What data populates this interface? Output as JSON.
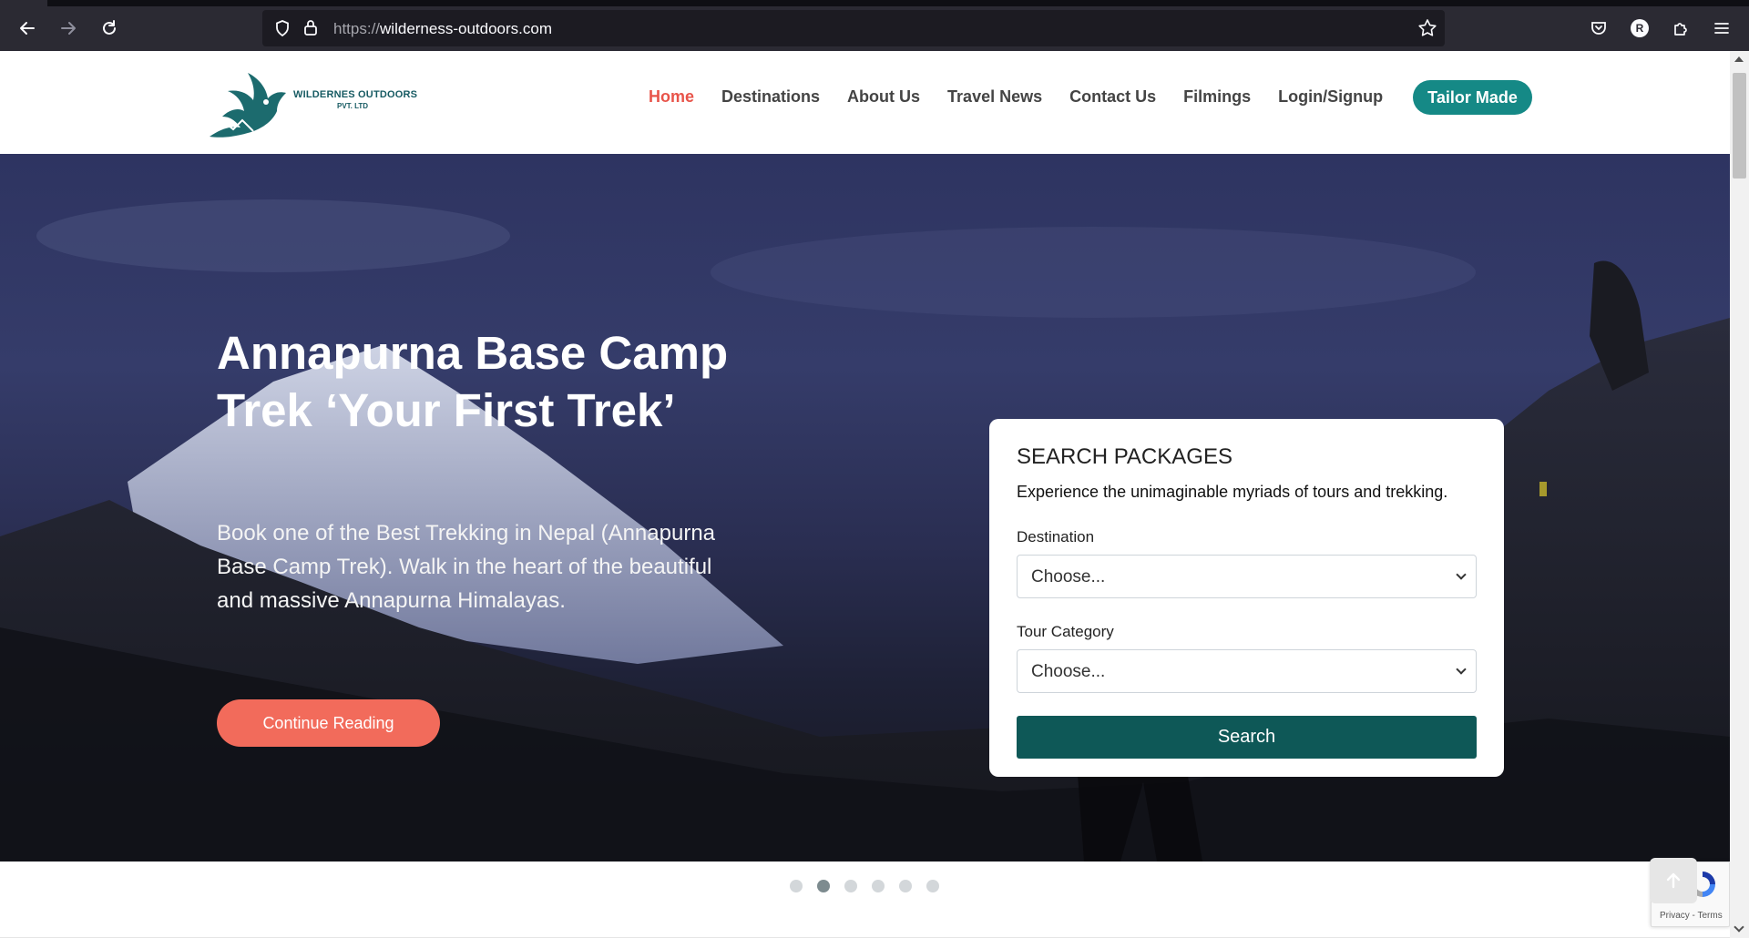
{
  "browser": {
    "url_protocol": "https://",
    "url_host": "wilderness-outdoors.com",
    "profile_initial": "R"
  },
  "header": {
    "logo_brand": "WILDERNES OUTDOORS",
    "logo_sub": "PVT. LTD",
    "menu": [
      {
        "label": "Home",
        "active": true
      },
      {
        "label": "Destinations"
      },
      {
        "label": "About Us"
      },
      {
        "label": "Travel News"
      },
      {
        "label": "Contact Us"
      },
      {
        "label": "Filmings"
      },
      {
        "label": "Login/Signup"
      }
    ],
    "cta_label": "Tailor Made"
  },
  "hero": {
    "title": "Annapurna Base Camp Trek ‘Your First Trek’",
    "text": "Book one of the Best Trekking in Nepal (Annapurna Base Camp Trek). Walk in the heart of the beautiful and massive Annapurna Himalayas.",
    "button_label": "Continue Reading",
    "slides_count": 6,
    "active_slide": 2
  },
  "search": {
    "title": "SEARCH PACKAGES",
    "subtitle": "Experience the unimaginable myriads of tours and trekking.",
    "destination_label": "Destination",
    "destination_value": "Choose...",
    "category_label": "Tour Category",
    "category_value": "Choose...",
    "button_label": "Search"
  },
  "recaptcha": {
    "terms": "Privacy - Terms"
  },
  "colors": {
    "accent_teal": "#158986",
    "search_button": "#0e5857",
    "coral": "#f26b5b",
    "active_menu": "#e8544a"
  }
}
